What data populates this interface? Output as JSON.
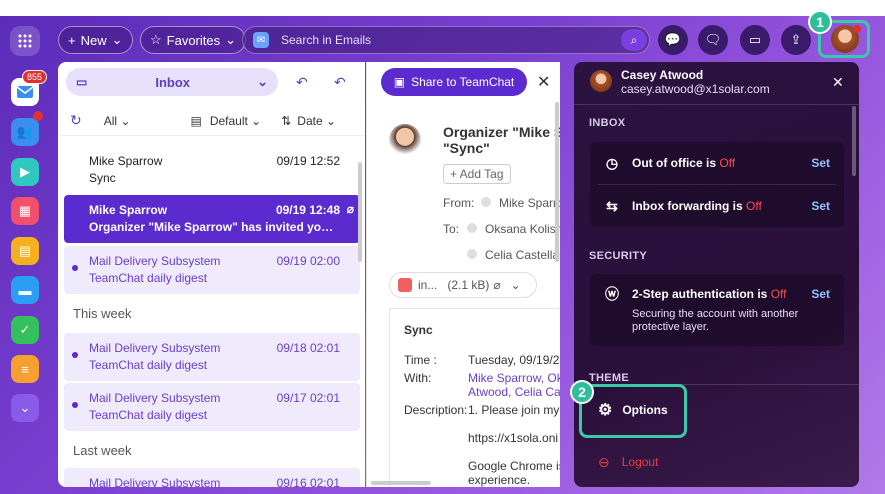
{
  "topbar": {
    "new_label": "New",
    "favorites_label": "Favorites",
    "search_placeholder": "Search in Emails"
  },
  "dock": {
    "mail_badge": "855"
  },
  "list": {
    "folder": "Inbox",
    "filter_all": "All",
    "sort_default": "Default",
    "sort_date": "Date",
    "rows": [
      {
        "from": "Mike Sparrow",
        "date": "09/19 12:52",
        "subject": "Sync"
      },
      {
        "from": "Mike Sparrow",
        "date": "09/19 12:48",
        "subject": "Organizer \"Mike Sparrow\" has invited you to \"S..."
      },
      {
        "from": "Mail Delivery Subsystem",
        "date": "09/19 02:00",
        "subject": "TeamChat daily digest"
      },
      {
        "from": "Mail Delivery Subsystem",
        "date": "09/18 02:01",
        "subject": "TeamChat daily digest"
      },
      {
        "from": "Mail Delivery Subsystem",
        "date": "09/17 02:01",
        "subject": "TeamChat daily digest"
      },
      {
        "from": "Mail Delivery Subsystem",
        "date": "09/16 02:01",
        "subject": ""
      }
    ],
    "section_this_week": "This week",
    "section_last_week": "Last week"
  },
  "reader": {
    "share_label": "Share to TeamChat",
    "title_line1": "Organizer \"Mike Sp",
    "title_line2": "\"Sync\"",
    "add_tag": "+ Add Tag",
    "from_label": "From:",
    "from_value": "Mike Sparro",
    "to_label": "To:",
    "to_1": "Oksana Kolisny",
    "to_2": "Celia Castellan",
    "attach_name": "in...",
    "attach_size": "(2.1 kB)",
    "body_title": "Sync",
    "time_label": "Time :",
    "time_value": "Tuesday, 09/19/2",
    "with_label": "With:",
    "with_value_1": "Mike Sparrow, Oks",
    "with_value_2": "Atwood",
    "with_value_3": "Celia Cas",
    "desc_label": "Description:",
    "desc_value": "1. Please join my",
    "link": "https://x1sola.oni",
    "chrome_line1": "Google Chrome is",
    "chrome_line2": "experience."
  },
  "profile": {
    "name": "Casey Atwood",
    "email": "casey.atwood@x1solar.com",
    "inbox_section": "INBOX",
    "out_of_office": "Out of office is",
    "out_of_office_state": "Off",
    "inbox_forwarding": "Inbox forwarding is",
    "inbox_forwarding_state": "Off",
    "set_label": "Set",
    "security_section": "SECURITY",
    "two_step": "2-Step authentication is",
    "two_step_state": "Off",
    "two_step_desc": "Securing the account with another protective layer.",
    "theme_section": "THEME",
    "options": "Options",
    "logout": "Logout"
  },
  "callouts": {
    "one": "1",
    "two": "2"
  },
  "colors": {
    "accent": "#5b2bd0",
    "highlight": "#3cc9a8",
    "off": "#ff4d4d"
  }
}
